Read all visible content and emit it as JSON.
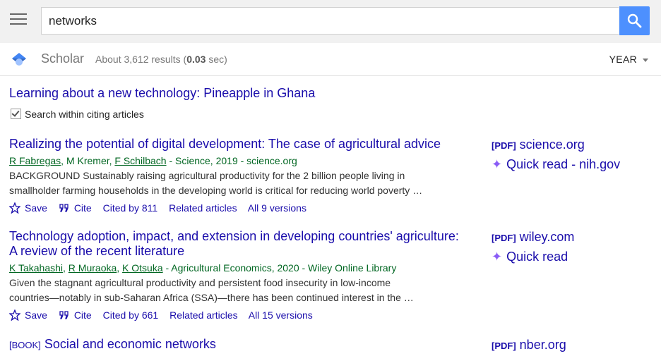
{
  "search": {
    "query": "networks"
  },
  "subbar": {
    "app_name": "Scholar",
    "results_prefix": "About 3,612 results (",
    "results_time": "0.03",
    "results_suffix": " sec)",
    "year_filter": "YEAR"
  },
  "cited_article": {
    "title": "Learning about a new technology: Pineapple in Ghana",
    "citing_label": "Search within citing articles",
    "citing_checked": true
  },
  "results": [
    {
      "title": "Realizing the potential of digital development: The case of agricultural advice",
      "authors": [
        {
          "name": "R Fabregas",
          "linked": true
        },
        {
          "name": "M Kremer",
          "linked": false
        },
        {
          "name": "F Schilbach",
          "linked": true
        }
      ],
      "source": " - Science, 2019 - science.org",
      "snippet1": "BACKGROUND Sustainably raising agricultural productivity for the 2 billion people living in",
      "snippet2": "smallholder farming households in the developing world is critical for reducing world poverty …",
      "save": "Save",
      "cite": "Cite",
      "cited_by": "Cited by 811",
      "related": "Related articles",
      "versions": "All 9 versions",
      "side_tag": "[PDF]",
      "side_source": "science.org",
      "side_quick": "Quick read - nih.gov"
    },
    {
      "title1": "Technology adoption, impact, and extension in developing countries' agriculture:",
      "title2": "A review of the recent literature",
      "authors": [
        {
          "name": "K Takahashi",
          "linked": true
        },
        {
          "name": "R Muraoka",
          "linked": true
        },
        {
          "name": "K Otsuka",
          "linked": true
        }
      ],
      "source": " - Agricultural Economics, 2020 - Wiley Online Library",
      "snippet1": "Given the stagnant agricultural productivity and persistent food insecurity in low-income",
      "snippet2": "countries—notably in sub-Saharan Africa (SSA)—there has been continued interest in the …",
      "save": "Save",
      "cite": "Cite",
      "cited_by": "Cited by 661",
      "related": "Related articles",
      "versions": "All 15 versions",
      "side_tag": "[PDF]",
      "side_source": "wiley.com",
      "side_quick": "Quick read"
    },
    {
      "tag": "[BOOK]",
      "title": "Social and economic networks",
      "side_tag": "[PDF]",
      "side_source": "nber.org"
    }
  ],
  "colors": {
    "link": "#1a0dab",
    "meta": "#006621",
    "accent": "#4d90fe",
    "quick_read": "#8a5cf6"
  }
}
